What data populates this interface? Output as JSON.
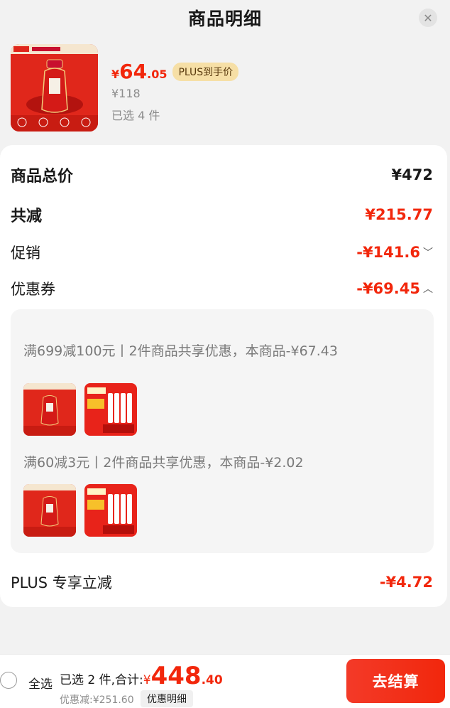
{
  "header": {
    "title": "商品明细",
    "close_icon": "close-icon"
  },
  "product": {
    "price_symbol": "¥",
    "price_int": "64",
    "price_dec": ".05",
    "plus_badge": "PLUS到手价",
    "original_price": "¥118",
    "selected": "已选 4 件"
  },
  "summary": {
    "total_label": "商品总价",
    "total_value": "¥472",
    "reduce_label": "共减",
    "reduce_value": "¥215.77",
    "promo_label": "促销",
    "promo_value": "-¥141.6",
    "coupon_label": "优惠券",
    "coupon_value": "-¥69.45",
    "plus_label": "PLUS 专享立减",
    "plus_value": "-¥4.72"
  },
  "coupons": [
    {
      "text": "满699减100元丨2件商品共享优惠，本商品-¥67.43"
    },
    {
      "text": "满60减3元丨2件商品共享优惠，本商品-¥2.02"
    }
  ],
  "bottom": {
    "select_all": "全选",
    "total_label": "已选 2 件,合计:",
    "total_yen": "¥",
    "total_int": "448",
    "total_dec": ".40",
    "discount": "优惠减:¥251.60",
    "detail_button": "优惠明细",
    "checkout_button": "去结算"
  },
  "colors": {
    "accent": "#f2270c",
    "plus_gold": "#f6dfa6"
  }
}
